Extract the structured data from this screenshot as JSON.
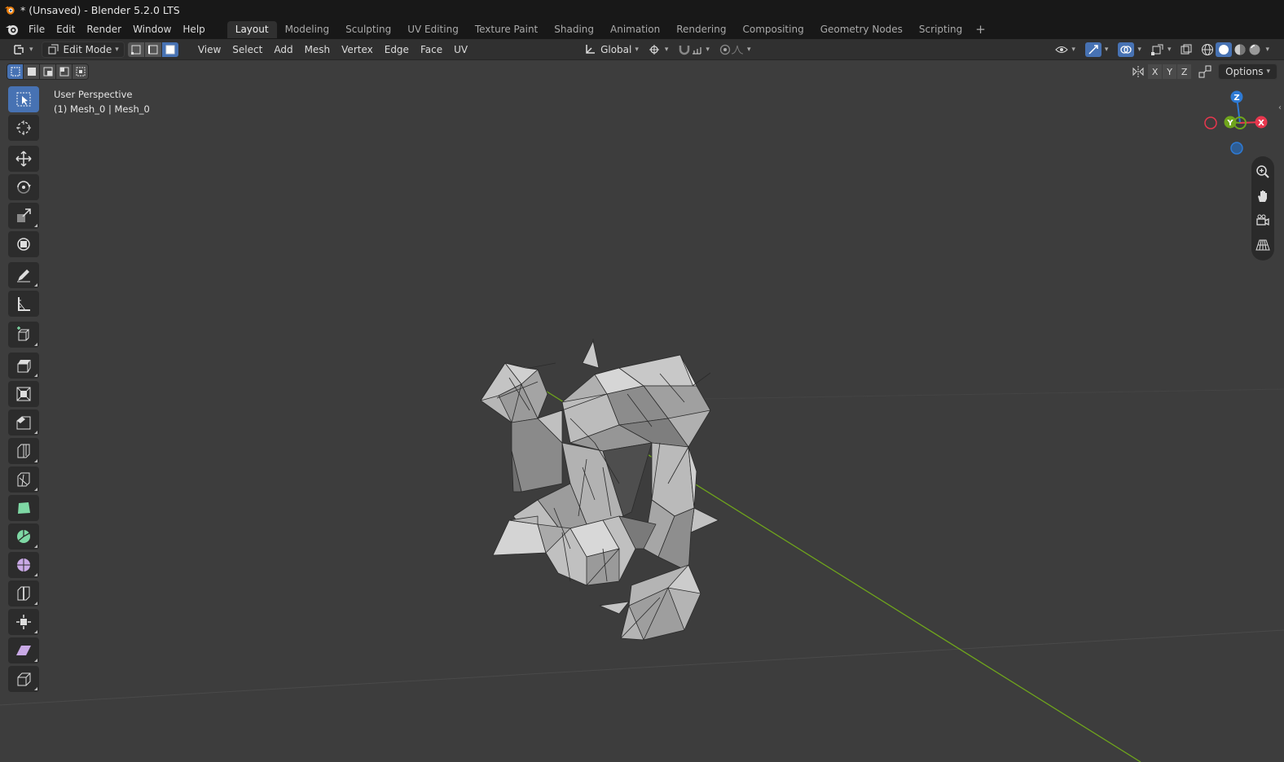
{
  "window": {
    "title": "* (Unsaved) - Blender 5.2.0 LTS"
  },
  "menubar": {
    "items": [
      "File",
      "Edit",
      "Render",
      "Window",
      "Help"
    ],
    "workspaces": [
      "Layout",
      "Modeling",
      "Sculpting",
      "UV Editing",
      "Texture Paint",
      "Shading",
      "Animation",
      "Rendering",
      "Compositing",
      "Geometry Nodes",
      "Scripting"
    ],
    "active_workspace": "Layout",
    "add_symbol": "+"
  },
  "header": {
    "mode": "Edit Mode",
    "menus": [
      "View",
      "Select",
      "Add",
      "Mesh",
      "Vertex",
      "Edge",
      "Face",
      "UV"
    ],
    "orientation": "Global"
  },
  "viewport": {
    "view_name": "User Perspective",
    "object_info": "(1) Mesh_0 | Mesh_0",
    "axes": [
      "X",
      "Y",
      "Z"
    ],
    "options_label": "Options",
    "gizmo": {
      "x_label": "X",
      "y_label": "Y",
      "z_label": "Z",
      "x_color": "#e8374e",
      "y_color": "#6fa51c",
      "z_color": "#2e7ad4"
    }
  },
  "colors": {
    "accent": "#4772b3",
    "background": "#3d3d3d",
    "mesh": "#a8a8a8"
  }
}
